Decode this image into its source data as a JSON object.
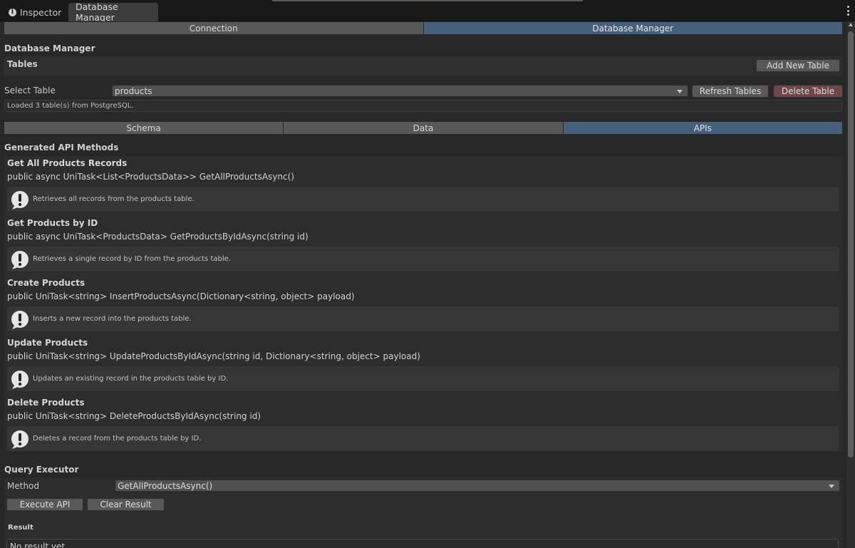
{
  "window": {
    "tabs": [
      {
        "label": "Inspector",
        "icon": "info-icon"
      },
      {
        "label": "Database Manager"
      }
    ]
  },
  "top_tabs": [
    "Connection",
    "Database Manager"
  ],
  "top_tabs_active": "Database Manager",
  "section_title": "Database Manager",
  "tables": {
    "header": "Tables",
    "add_button": "Add New Table",
    "select_label": "Select Table",
    "selected_table": "products",
    "refresh_button": "Refresh Tables",
    "delete_button": "Delete Table",
    "status": "Loaded 3 table(s) from PostgreSQL."
  },
  "sub_tabs": [
    "Schema",
    "Data",
    "APIs"
  ],
  "sub_tabs_active": "APIs",
  "api_header": "Generated API Methods",
  "apis": [
    {
      "title": "Get All Products Records",
      "signature": "public async UniTask<List<ProductsData>> GetAllProductsAsync()",
      "description": "Retrieves all records from the products table."
    },
    {
      "title": "Get Products by ID",
      "signature": "public async UniTask<ProductsData> GetProductsByIdAsync(string id)",
      "description": "Retrieves a single record by ID from the products table."
    },
    {
      "title": "Create Products",
      "signature": "public UniTask<string> InsertProductsAsync(Dictionary<string, object> payload)",
      "description": "Inserts a new record into the products table."
    },
    {
      "title": "Update Products",
      "signature": "public UniTask<string> UpdateProductsByIdAsync(string id, Dictionary<string, object> payload)",
      "description": "Updates an existing record in the products table by ID."
    },
    {
      "title": "Delete Products",
      "signature": "public UniTask<string> DeleteProductsByIdAsync(string id)",
      "description": "Deletes a record from the products table by ID."
    }
  ],
  "query": {
    "header": "Query Executor",
    "method_label": "Method",
    "method_value": "GetAllProductsAsync()",
    "execute_button": "Execute API",
    "clear_button": "Clear Result",
    "result_label": "Result",
    "result_value": "No result yet."
  },
  "colors": {
    "active_tab": "#46607c",
    "danger_button": "#6f4748",
    "panel_bg": "#282828"
  }
}
